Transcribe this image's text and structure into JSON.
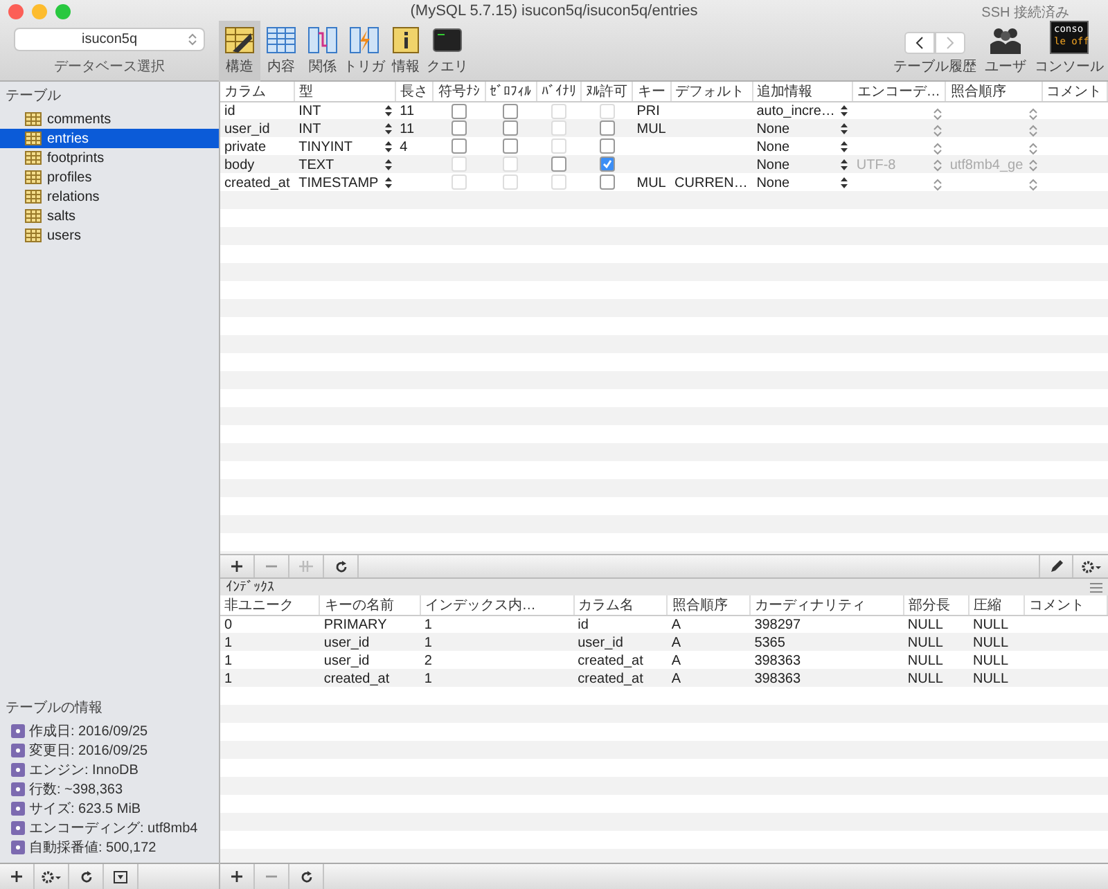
{
  "window": {
    "title": "(MySQL 5.7.15) isucon5q/isucon5q/entries",
    "ssh_status": "SSH 接続済み"
  },
  "database_selector": {
    "value": "isucon5q",
    "label": "データベース選択"
  },
  "toolbar": {
    "tabs": [
      {
        "kind": "structure",
        "label": "構造",
        "selected": true
      },
      {
        "kind": "content",
        "label": "内容",
        "selected": false
      },
      {
        "kind": "relations",
        "label": "関係",
        "selected": false
      },
      {
        "kind": "triggers",
        "label": "トリガ",
        "selected": false
      },
      {
        "kind": "info",
        "label": "情報",
        "selected": false
      },
      {
        "kind": "query",
        "label": "クエリ",
        "selected": false
      }
    ],
    "history_label": "テーブル履歴",
    "users_label": "ユーザ",
    "console_label": "コンソール",
    "console_badge": [
      "conso",
      "le off"
    ]
  },
  "tables": {
    "title": "テーブル",
    "items": [
      {
        "name": "comments",
        "selected": false
      },
      {
        "name": "entries",
        "selected": true
      },
      {
        "name": "footprints",
        "selected": false
      },
      {
        "name": "profiles",
        "selected": false
      },
      {
        "name": "relations",
        "selected": false
      },
      {
        "name": "salts",
        "selected": false
      },
      {
        "name": "users",
        "selected": false
      }
    ]
  },
  "table_info": {
    "title": "テーブルの情報",
    "items": [
      "作成日: 2016/09/25",
      "変更日: 2016/09/25",
      "エンジン: InnoDB",
      "行数: ~398,363",
      "サイズ: 623.5 MiB",
      "エンコーディング: utf8mb4",
      "自動採番値: 500,172"
    ]
  },
  "fields": {
    "columns": [
      "カラム",
      "型",
      "長さ",
      "符号ﾅｼ",
      "ｾﾞﾛﾌｨﾙ",
      "ﾊﾞｲﾅﾘ",
      "ﾇﾙ許可",
      "キー",
      "デフォルト",
      "追加情報",
      "エンコーデ…",
      "照合順序",
      "コメント"
    ],
    "rows": [
      {
        "name": "id",
        "type": "INT",
        "length": "11",
        "flags": [
          {
            "checked": false,
            "disabled": false
          },
          {
            "checked": false,
            "disabled": false
          },
          {
            "checked": false,
            "disabled": true
          },
          {
            "checked": false,
            "disabled": true
          }
        ],
        "key": "PRI",
        "default": "",
        "extra": "auto_incre…",
        "encoding": "",
        "collation": ""
      },
      {
        "name": "user_id",
        "type": "INT",
        "length": "11",
        "flags": [
          {
            "checked": false,
            "disabled": false
          },
          {
            "checked": false,
            "disabled": false
          },
          {
            "checked": false,
            "disabled": true
          },
          {
            "checked": false,
            "disabled": false
          }
        ],
        "key": "MUL",
        "default": "",
        "extra": "None",
        "encoding": "",
        "collation": ""
      },
      {
        "name": "private",
        "type": "TINYINT",
        "length": "4",
        "flags": [
          {
            "checked": false,
            "disabled": false
          },
          {
            "checked": false,
            "disabled": false
          },
          {
            "checked": false,
            "disabled": true
          },
          {
            "checked": false,
            "disabled": false
          }
        ],
        "key": "",
        "default": "",
        "extra": "None",
        "encoding": "",
        "collation": ""
      },
      {
        "name": "body",
        "type": "TEXT",
        "length": "",
        "flags": [
          {
            "checked": false,
            "disabled": true
          },
          {
            "checked": false,
            "disabled": true
          },
          {
            "checked": false,
            "disabled": false
          },
          {
            "checked": true,
            "disabled": false
          }
        ],
        "key": "",
        "default": "",
        "extra": "None",
        "encoding": "UTF-8",
        "collation": "utf8mb4_ge"
      },
      {
        "name": "created_at",
        "type": "TIMESTAMP",
        "length": "",
        "flags": [
          {
            "checked": false,
            "disabled": true
          },
          {
            "checked": false,
            "disabled": true
          },
          {
            "checked": false,
            "disabled": true
          },
          {
            "checked": false,
            "disabled": false
          }
        ],
        "key": "MUL",
        "default": "CURREN…",
        "extra": "None",
        "encoding": "",
        "collation": ""
      }
    ]
  },
  "indexes": {
    "title": "ｲﾝﾃﾞｯｸｽ",
    "columns": [
      "非ユニーク",
      "キーの名前",
      "インデックス内…",
      "カラム名",
      "照合順序",
      "カーディナリティ",
      "部分長",
      "圧縮",
      "コメント"
    ],
    "rows": [
      [
        "0",
        "PRIMARY",
        "1",
        "id",
        "A",
        "398297",
        "NULL",
        "NULL",
        ""
      ],
      [
        "1",
        "user_id",
        "1",
        "user_id",
        "A",
        "5365",
        "NULL",
        "NULL",
        ""
      ],
      [
        "1",
        "user_id",
        "2",
        "created_at",
        "A",
        "398363",
        "NULL",
        "NULL",
        ""
      ],
      [
        "1",
        "created_at",
        "1",
        "created_at",
        "A",
        "398363",
        "NULL",
        "NULL",
        ""
      ]
    ]
  }
}
